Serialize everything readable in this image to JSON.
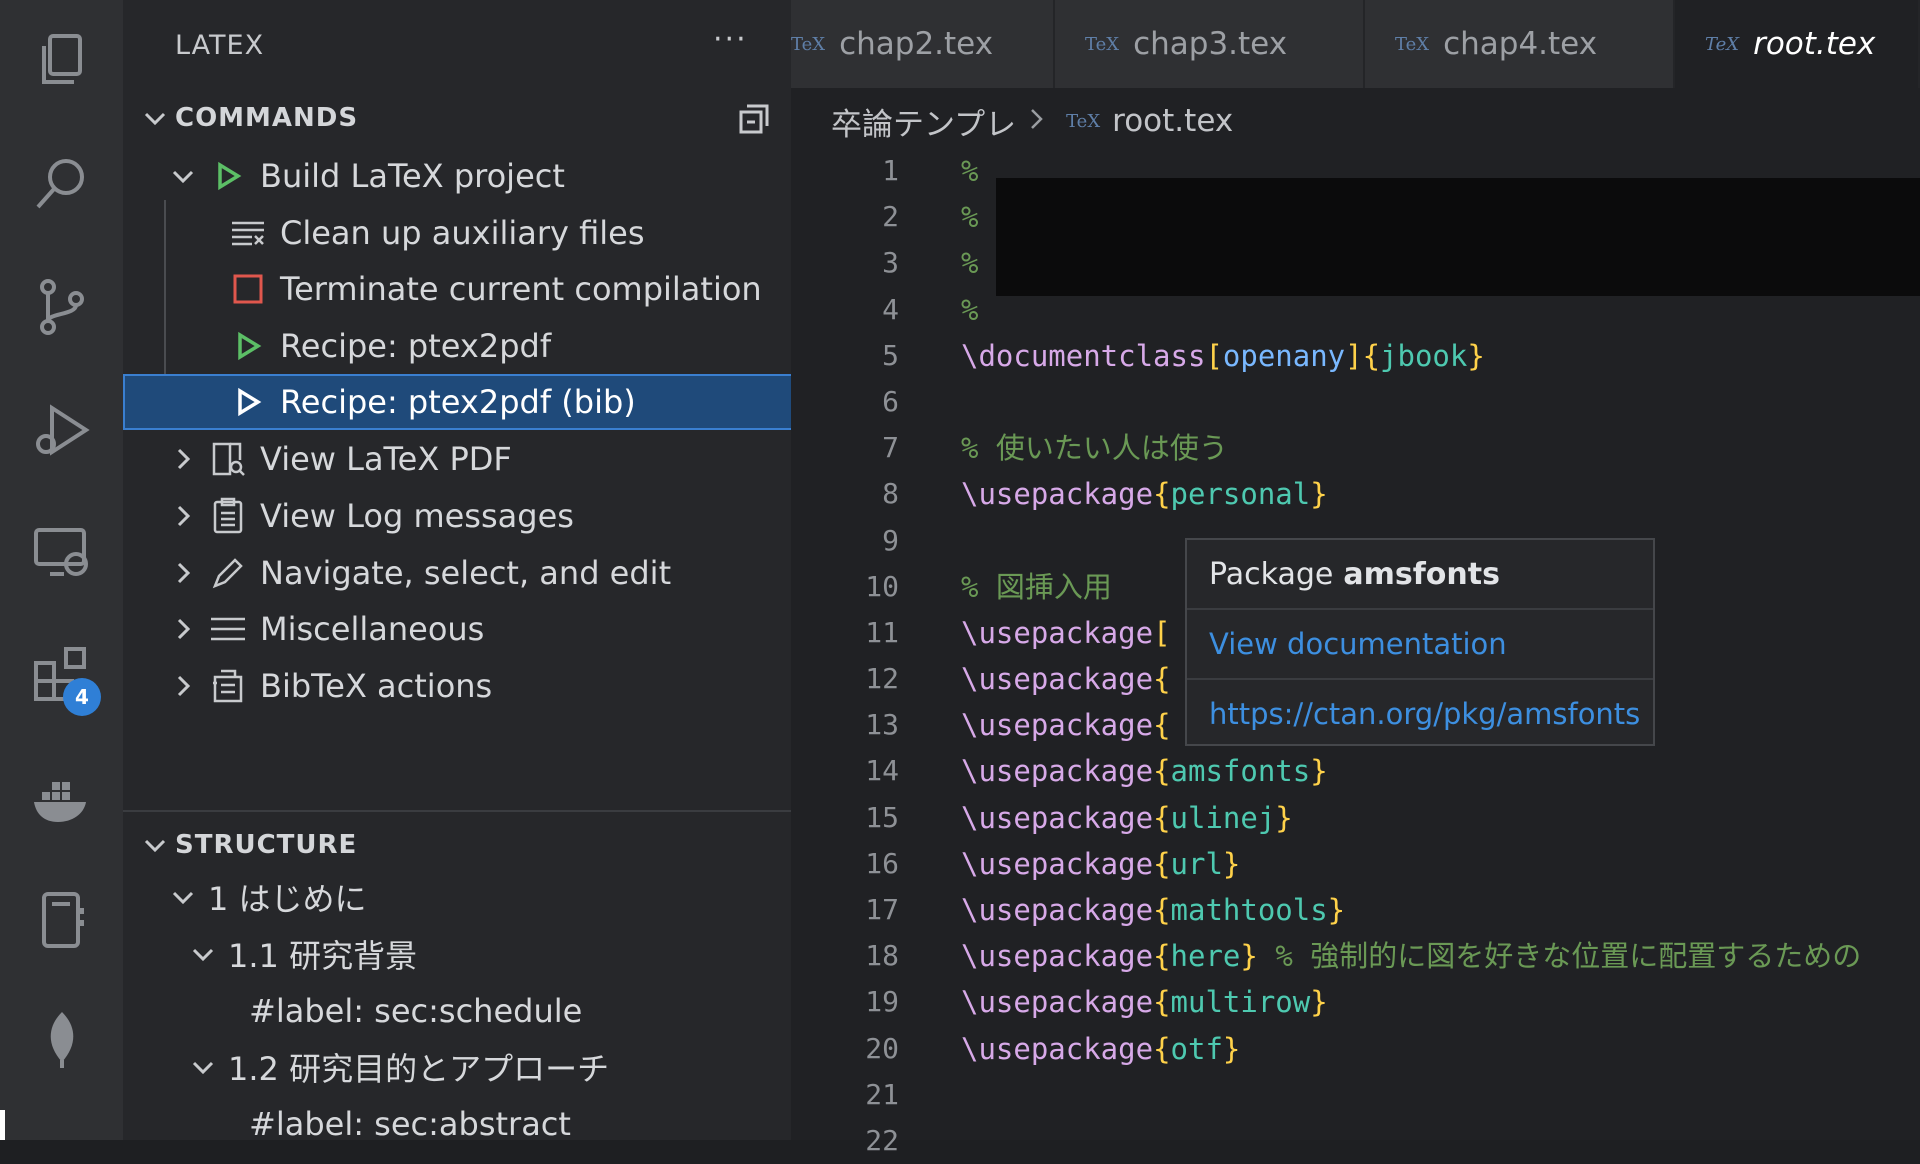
{
  "sidebar": {
    "title": "LATEX",
    "more": "···",
    "commands_header": "COMMANDS",
    "commands": [
      {
        "label": "Build LaTeX project",
        "icon": "play-icon"
      },
      {
        "label": "Clean up auxiliary files",
        "icon": "clear-all-icon"
      },
      {
        "label": "Terminate current compilation",
        "icon": "stop-icon"
      },
      {
        "label": "Recipe: ptex2pdf",
        "icon": "play-icon"
      },
      {
        "label": "Recipe: ptex2pdf (bib)",
        "icon": "play-icon",
        "selected": true
      },
      {
        "label": "View LaTeX PDF",
        "icon": "preview-icon"
      },
      {
        "label": "View Log messages",
        "icon": "log-icon"
      },
      {
        "label": "Navigate, select, and edit",
        "icon": "edit-icon"
      },
      {
        "label": "Miscellaneous",
        "icon": "menu-icon"
      },
      {
        "label": "BibTeX actions",
        "icon": "bib-icon"
      }
    ],
    "structure_header": "STRUCTURE",
    "structure": [
      "1 はじめに",
      "1.1 研究背景",
      "#label: sec:schedule",
      "1.2 研究目的とアプローチ",
      "#label: sec:abstract"
    ]
  },
  "activity": {
    "extensions_badge": "4"
  },
  "tabs": [
    {
      "label": "chap2.tex",
      "active": false
    },
    {
      "label": "chap3.tex",
      "active": false
    },
    {
      "label": "chap4.tex",
      "active": false
    },
    {
      "label": "root.tex",
      "active": true
    }
  ],
  "tex_icon_text": "TeX",
  "breadcrumb": {
    "folder": "卒論テンプレ",
    "file": "root.tex"
  },
  "line_numbers": [
    "1",
    "2",
    "3",
    "4",
    "5",
    "6",
    "7",
    "8",
    "9",
    "10",
    "11",
    "12",
    "13",
    "14",
    "15",
    "16",
    "17",
    "18",
    "19",
    "20",
    "21",
    "22"
  ],
  "code": {
    "l1": "%",
    "l2": "%",
    "l3": "%",
    "l4": "%",
    "l5_cmd": "\\documentclass",
    "l5_opt": "openany",
    "l5_arg": "jbook",
    "l7": "% 使いたい人は使う",
    "l8_cmd": "\\usepackage",
    "l8_arg": "personal",
    "l10": "% 図挿入用",
    "l11_cmd": "\\usepackage",
    "l12_cmd": "\\usepackage",
    "l13_cmd": "\\usepackage",
    "l14_cmd": "\\usepackage",
    "l14_arg": "amsfonts",
    "l15_cmd": "\\usepackage",
    "l15_arg": "ulinej",
    "l16_cmd": "\\usepackage",
    "l16_arg": "url",
    "l17_cmd": "\\usepackage",
    "l17_arg": "mathtools",
    "l18_cmd": "\\usepackage",
    "l18_arg": "here",
    "l18_comment": "% 強制的に図を好きな位置に配置するための",
    "l19_cmd": "\\usepackage",
    "l19_arg": "multirow",
    "l20_cmd": "\\usepackage",
    "l20_arg": "otf"
  },
  "hover": {
    "prefix": "Package",
    "name": "amsfonts",
    "doc_link": "View documentation",
    "url": "https://ctan.org/pkg/amsfonts"
  },
  "colors": {
    "selection": "#1f4a7a",
    "link": "#3d8fe0",
    "keyword": "#d7a9e8",
    "argument": "#4ec9b0"
  }
}
